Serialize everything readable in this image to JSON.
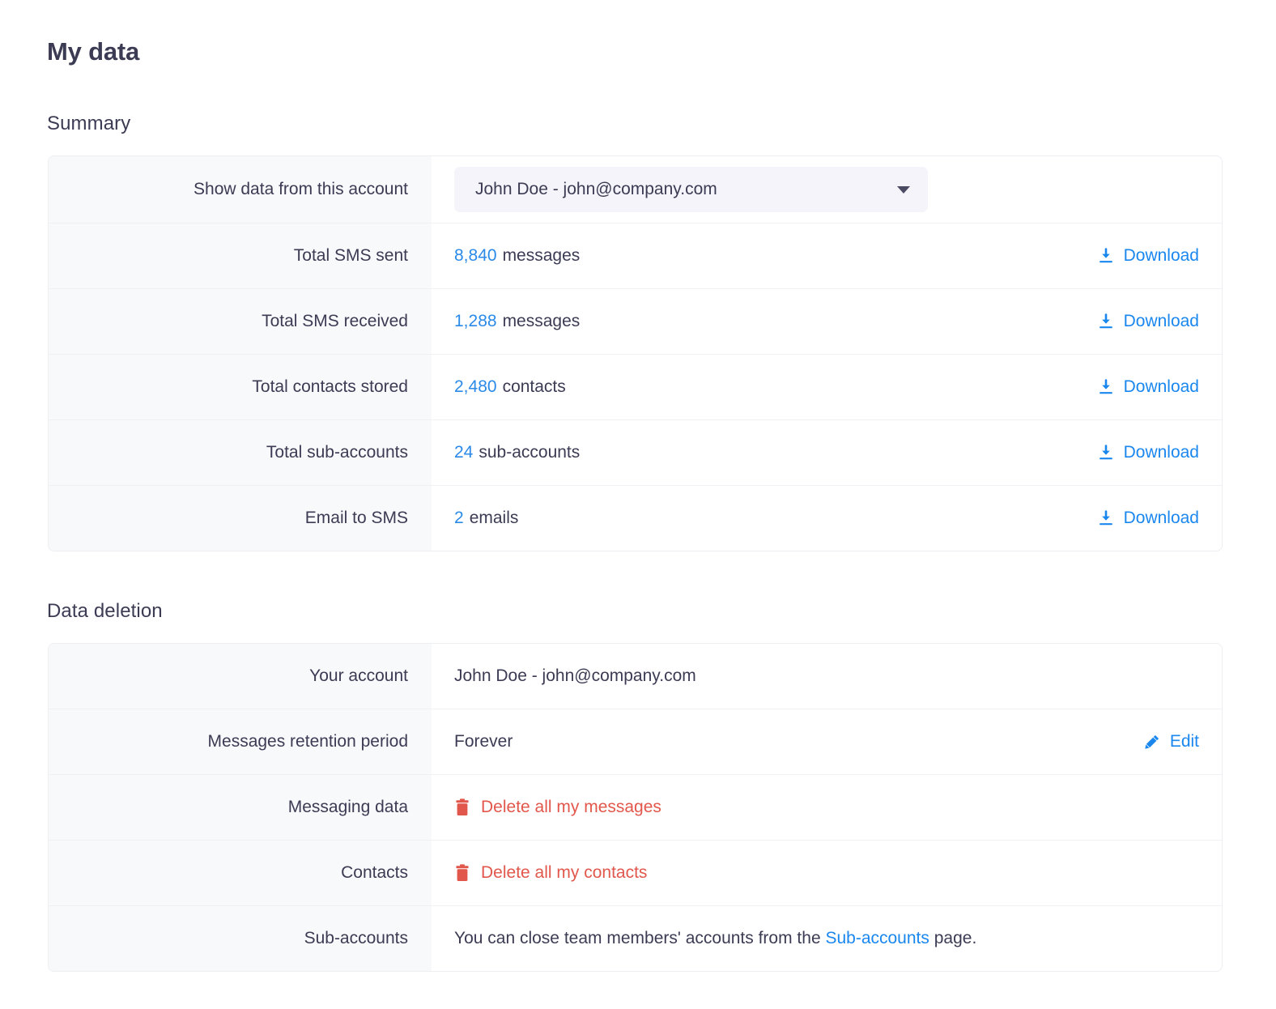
{
  "page": {
    "title": "My data"
  },
  "summary": {
    "heading": "Summary",
    "account_row": {
      "label": "Show data from this account",
      "selected": "John Doe - john@company.com",
      "caret_icon": "chevron-down-icon"
    },
    "download_label": "Download",
    "download_icon": "download-icon",
    "rows": [
      {
        "label": "Total SMS sent",
        "number": "8,840",
        "unit": "messages",
        "action": "Download"
      },
      {
        "label": "Total SMS received",
        "number": "1,288",
        "unit": "messages",
        "action": "Download"
      },
      {
        "label": "Total contacts stored",
        "number": "2,480",
        "unit": "contacts",
        "action": "Download"
      },
      {
        "label": "Total sub-accounts",
        "number": "24",
        "unit": "sub-accounts",
        "action": "Download"
      },
      {
        "label": "Email to SMS",
        "number": "2",
        "unit": "emails",
        "action": "Download"
      }
    ]
  },
  "deletion": {
    "heading": "Data deletion",
    "account": {
      "label": "Your account",
      "value": "John Doe - john@company.com"
    },
    "retention": {
      "label": "Messages retention period",
      "value": "Forever",
      "edit_label": "Edit",
      "edit_icon": "pencil-icon"
    },
    "messaging": {
      "label": "Messaging data",
      "action_label": "Delete all my messages",
      "trash_icon": "trash-icon"
    },
    "contacts": {
      "label": "Contacts",
      "action_label": "Delete all my contacts",
      "trash_icon": "trash-icon"
    },
    "subaccounts": {
      "label": "Sub-accounts",
      "text_before": "You can close team members' accounts from the",
      "link_label": "Sub-accounts",
      "text_after": "page."
    }
  },
  "colors": {
    "accent_blue": "#1a87ef",
    "number_blue": "#2b8ae8",
    "danger_red": "#e2574c",
    "text_dark": "#3c3b54",
    "label_bg": "#f8f9fb",
    "select_bg": "#f4f4fa",
    "border": "#eceef2"
  }
}
